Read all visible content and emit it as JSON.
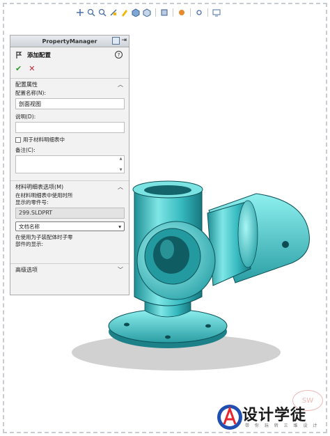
{
  "panel": {
    "header_title": "PropertyManager",
    "feature_title": "添加配置",
    "help_glyph": "?",
    "ok_glyph": "✔",
    "cancel_glyph": "✕"
  },
  "config_props": {
    "title": "配置属性",
    "name_label": "配置名称(N):",
    "name_value": "剖面视图",
    "desc_label": "说明(D):",
    "desc_value": "",
    "bom_checkbox_label": "用于材料明细表中",
    "comment_label": "备注(C):",
    "comment_value": ""
  },
  "bom_options": {
    "title": "材料明细表选项(M)",
    "part_label_line1": "在材料明细表中使用时所",
    "part_label_line2": "显示的零件号:",
    "part_value": "299.SLDPRT",
    "select_value": "文档名称",
    "child_label_line1": "在使用为子装配体时子零",
    "child_label_line2": "部件的显示:"
  },
  "advanced": {
    "title": "高级选项"
  },
  "branding": {
    "logo_text": "设计学徒",
    "logo_sub": "带 你 玩 转 三 维 设 计",
    "watermark": "SW"
  },
  "colors": {
    "part_teal": "#3fc9cc",
    "arrow_red": "#d0121b",
    "ok_green": "#2a9a2a"
  }
}
